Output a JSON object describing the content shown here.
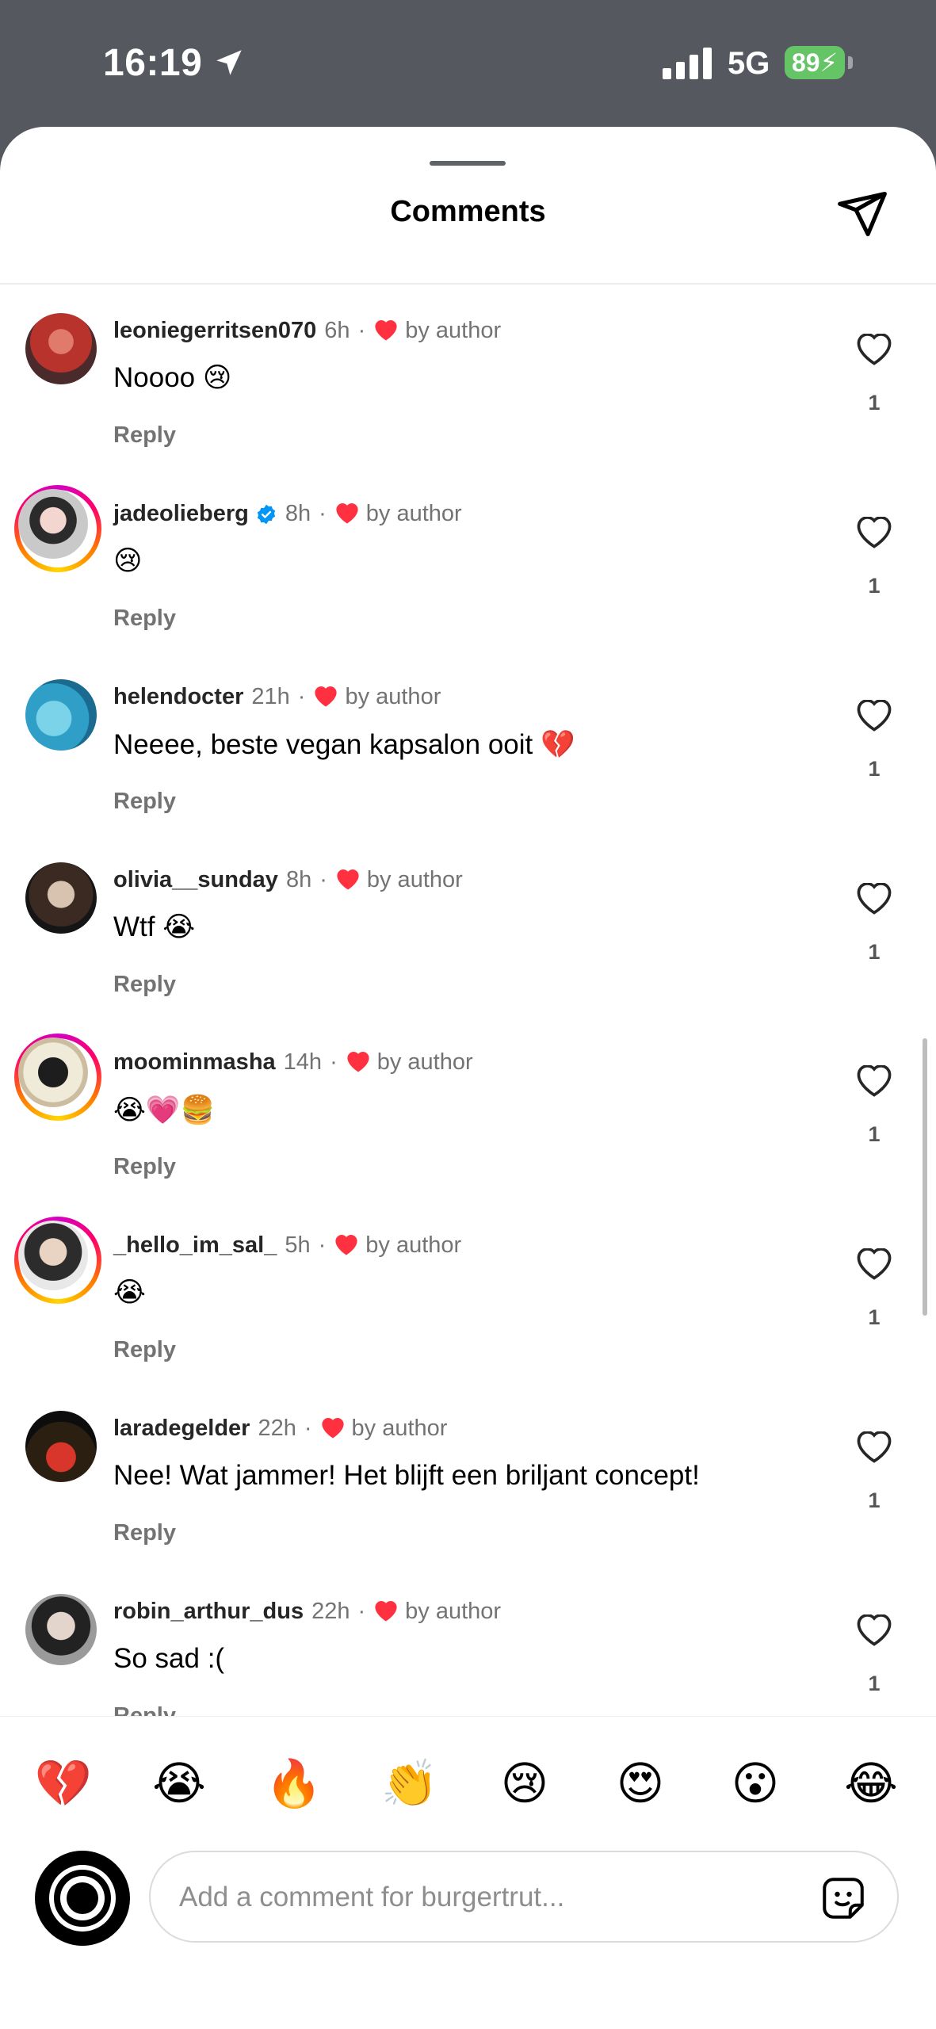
{
  "status_bar": {
    "time": "16:19",
    "network": "5G",
    "battery": "89"
  },
  "header": {
    "title": "Comments"
  },
  "liked_by_label": "by author",
  "reply_label": "Reply",
  "comments": [
    {
      "username": "leoniegerritsen070",
      "time": "6h",
      "text": "Noooo 😢",
      "likes": "1",
      "verified": false,
      "story_ring": false
    },
    {
      "username": "jadeolieberg",
      "time": "8h",
      "text": "😢",
      "likes": "1",
      "verified": true,
      "story_ring": true
    },
    {
      "username": "helendocter",
      "time": "21h",
      "text": "Neeee, beste vegan kapsalon ooit 💔",
      "likes": "1",
      "verified": false,
      "story_ring": false
    },
    {
      "username": "olivia__sunday",
      "time": "8h",
      "text": "Wtf 😭",
      "likes": "1",
      "verified": false,
      "story_ring": false
    },
    {
      "username": "moominmasha",
      "time": "14h",
      "text": "😭💗🍔",
      "likes": "1",
      "verified": false,
      "story_ring": true
    },
    {
      "username": "_hello_im_sal_",
      "time": "5h",
      "text": "😭",
      "likes": "1",
      "verified": false,
      "story_ring": true
    },
    {
      "username": "laradegelder",
      "time": "22h",
      "text": "Nee! Wat jammer! Het blijft een briljant concept!",
      "likes": "1",
      "verified": false,
      "story_ring": false
    },
    {
      "username": "robin_arthur_dus",
      "time": "22h",
      "text": "So sad :(",
      "likes": "1",
      "verified": false,
      "story_ring": false
    }
  ],
  "quick_reactions": [
    "💔",
    "😭",
    "🔥",
    "👏",
    "😢",
    "😍",
    "😮",
    "😂"
  ],
  "comment_input": {
    "placeholder": "Add a comment for burgertrut..."
  },
  "colors": {
    "like_red": "#ff3040",
    "verified_blue": "#0095f6",
    "battery_green": "#65c466",
    "status_bar_bg": "#55585e"
  }
}
